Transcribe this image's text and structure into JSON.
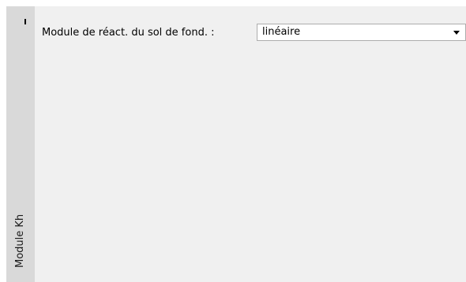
{
  "side_tab": {
    "label": "Module Kh"
  },
  "form": {
    "subgrade_modulus": {
      "label": "Module de réact. du sol de fond. :",
      "selected_value": "linéaire"
    }
  },
  "icons": {
    "tab_grip": "grip-icon",
    "dropdown": "chevron-down-icon"
  }
}
